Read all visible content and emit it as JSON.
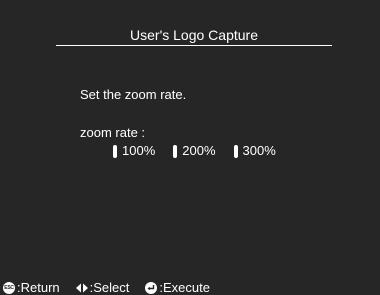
{
  "window": {
    "title": "User's Logo Capture"
  },
  "main": {
    "instruction": "Set the zoom rate.",
    "zoom_label": "zoom rate :",
    "zoom_options": [
      {
        "label": "100%"
      },
      {
        "label": "200%"
      },
      {
        "label": "300%"
      }
    ]
  },
  "footer": {
    "return_icon_text": "ESC",
    "return_label": ":Return",
    "select_label": ":Select",
    "execute_label": ":Execute"
  },
  "icons": {
    "return": "esc-button-icon",
    "select": "left-right-arrows-icon",
    "execute": "enter-icon"
  },
  "colors": {
    "background": "#262626",
    "foreground": "#ffffff"
  }
}
